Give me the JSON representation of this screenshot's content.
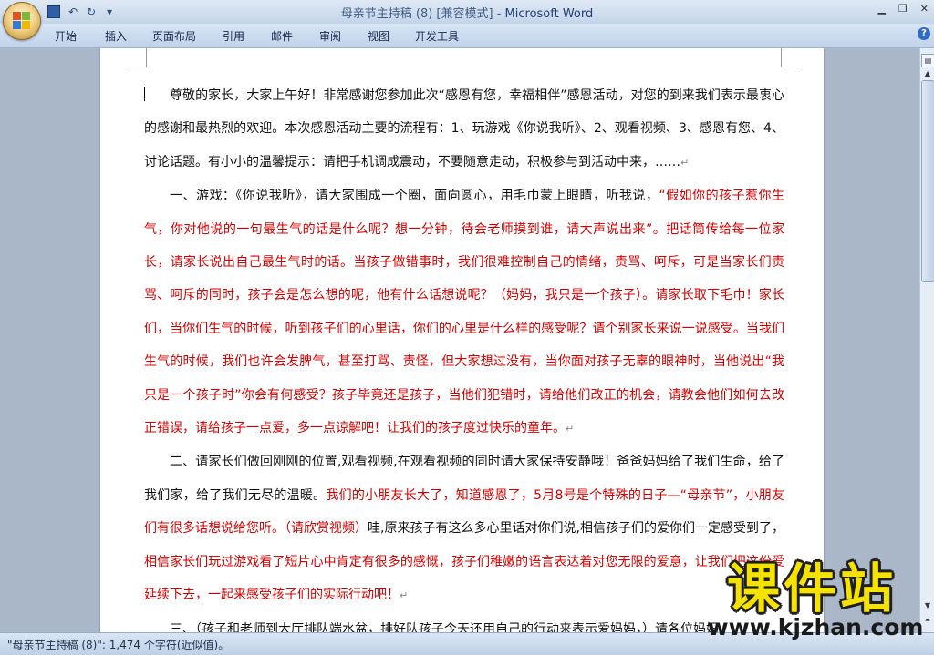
{
  "window": {
    "title": "母亲节主持稿 (8) [兼容模式]",
    "separator": " - ",
    "app_name": "Microsoft Word"
  },
  "quick_access": {
    "save_icon": "save-icon",
    "undo_icon": "undo-icon",
    "redo_icon": "redo-icon",
    "customize_icon": "dropdown-icon"
  },
  "ribbon_tabs": [
    "开始",
    "插入",
    "页面布局",
    "引用",
    "邮件",
    "审阅",
    "视图",
    "开发工具"
  ],
  "help_label": "?",
  "colors": {
    "emphasis_text": "#d40000",
    "normal_text": "#111111"
  },
  "document": {
    "p1": "尊敬的家长，大家上午好！非常感谢您参加此次“感恩有您，幸福相伴”感恩活动，对您的到来我们表示最衷心的感谢和最热烈的欢迎。本次感恩活动主要的流程有：1、玩游戏《你说我听》、2、观看视频、3、感恩有您、4、讨论话题。有小小的温馨提示：请把手机调成震动，不要随意走动，积极参与到活动中来，……",
    "p2_black": "一、游戏：《你说我听》，请大家围成一个圈，面向圆心，用毛巾蒙上眼睛，听我说，",
    "p2_red": "“假如你的孩子惹你生气，你对他说的一句最生气的话是什么呢？想一分钟，待会老师摸到谁，请大声说出来”。把话筒传给每一位家长，请家长说出自己最生气时的话。当孩子做错事时，我们很难控制自己的情绪，责骂、呵斥，可是当家长们责骂、呵斥的同时，孩子会是怎么想的呢，他有什么话想说呢？（妈妈，我只是一个孩子）。请家长取下毛巾！家长们，当你们生气的时候，听到孩子们的心里话，你们的心里是什么样的感受呢？请个别家长来说一说感受。当我们生气的时候，我们也许会发脾气，甚至打骂、责怪，但大家想过没有，当你面对孩子无辜的眼神时，当他说出“我只是一个孩子时”你会有何感受？孩子毕竟还是孩子，当他们犯错时，请给他们改正的机会，请教会他们如何去改正错误，请给孩子一点爱，多一点谅解吧！让我们的孩子度过快乐的童年。",
    "p3_black1": "二、请家长们做回刚刚的位置,观看视频,在观看视频的同时请大家保持安静哦！爸爸妈妈给了我们生命，给了我们家，给了我们无尽的温暖。",
    "p3_red1": "我们的小朋友长大了，知道感恩了，5月8号是个特殊的日子—“母亲节”，小朋友们有很多话想说给您听。",
    "p3_red2": "（请欣赏视频）",
    "p3_black2": "哇,原来孩子有这么多心里话对你们说,相信孩子们的爱你们一定感受到了，",
    "p3_red3": "相信家长们玩过游戏看了短片心中肯定有很多的感慨，孩子们稚嫩的语言表达着对您无限的爱意，让我们把这份爱延续下去，一起来感受孩子们的实际行动吧！",
    "p4": "三、（孩子和老师到大厅排队端水盆，排好队孩子今天还用自己的行动来表示爱妈妈，）请各位妈妈",
    "paragraph_mark": "↵"
  },
  "status_bar": {
    "text": "\"母亲节主持稿 (8)\": 1,474 个字符(近似值)。"
  },
  "watermark": {
    "main": "课件站",
    "url": "www.kjzhan.com"
  }
}
